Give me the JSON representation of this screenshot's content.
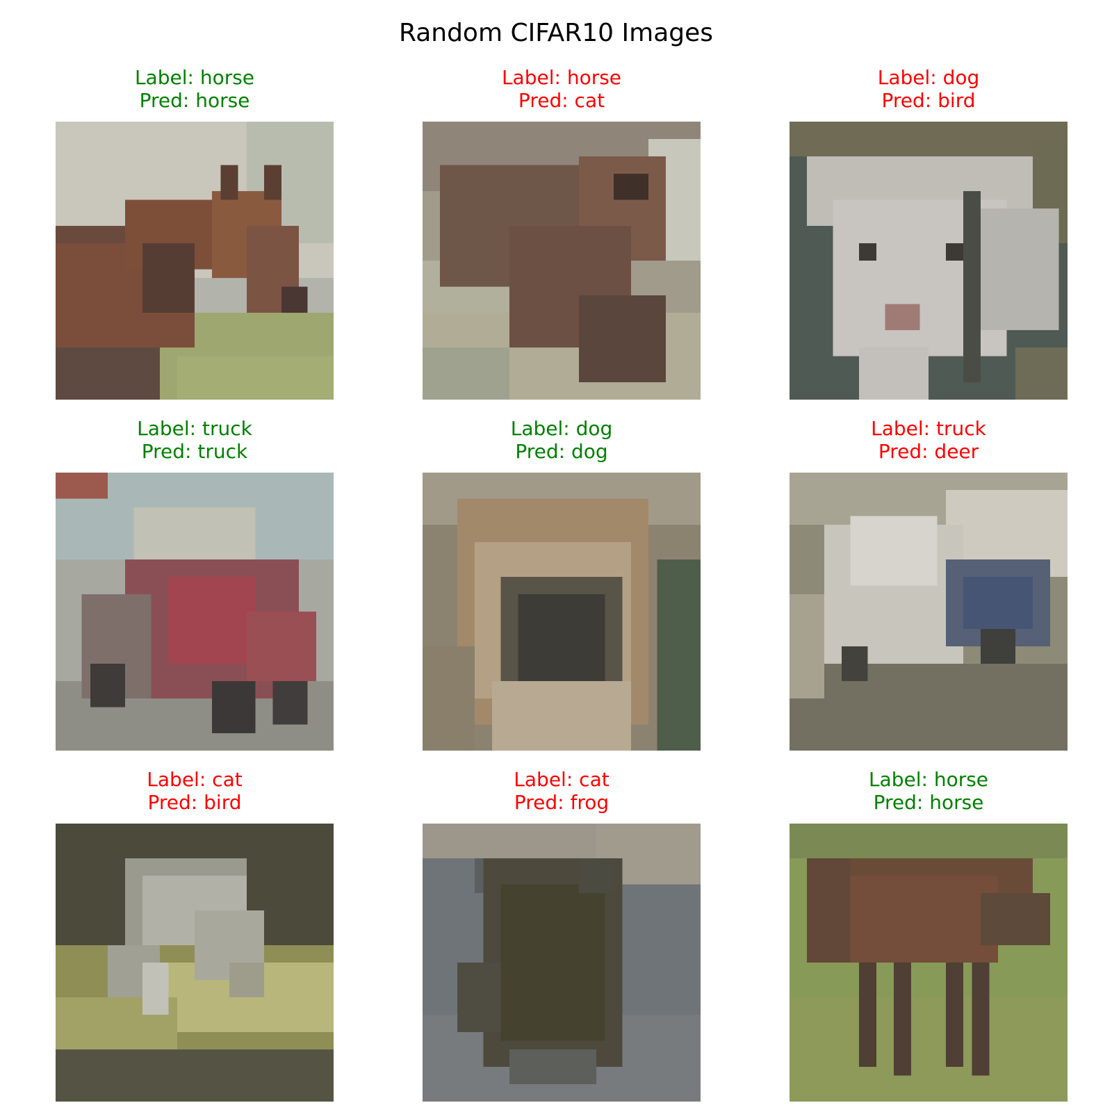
{
  "title": "Random CIFAR10 Images",
  "colors": {
    "correct": "#008000",
    "incorrect": "#ff0000"
  },
  "samples": [
    {
      "label": "Label: horse",
      "pred": "Pred: horse",
      "correct": true,
      "subject": "horse-head"
    },
    {
      "label": "Label: horse",
      "pred": "Pred: cat",
      "correct": false,
      "subject": "horse-closeup"
    },
    {
      "label": "Label: dog",
      "pred": "Pred: bird",
      "correct": false,
      "subject": "white-puppy"
    },
    {
      "label": "Label: truck",
      "pred": "Pred: truck",
      "correct": true,
      "subject": "red-truck"
    },
    {
      "label": "Label: dog",
      "pred": "Pred: dog",
      "correct": true,
      "subject": "dog-face"
    },
    {
      "label": "Label: truck",
      "pred": "Pred: deer",
      "correct": false,
      "subject": "white-tanker-truck"
    },
    {
      "label": "Label: cat",
      "pred": "Pred: bird",
      "correct": false,
      "subject": "tabby-cat-on-grass"
    },
    {
      "label": "Label: cat",
      "pred": "Pred: frog",
      "correct": false,
      "subject": "dark-cat-on-blanket"
    },
    {
      "label": "Label: horse",
      "pred": "Pred: horse",
      "correct": true,
      "subject": "brown-horse-in-field"
    }
  ]
}
